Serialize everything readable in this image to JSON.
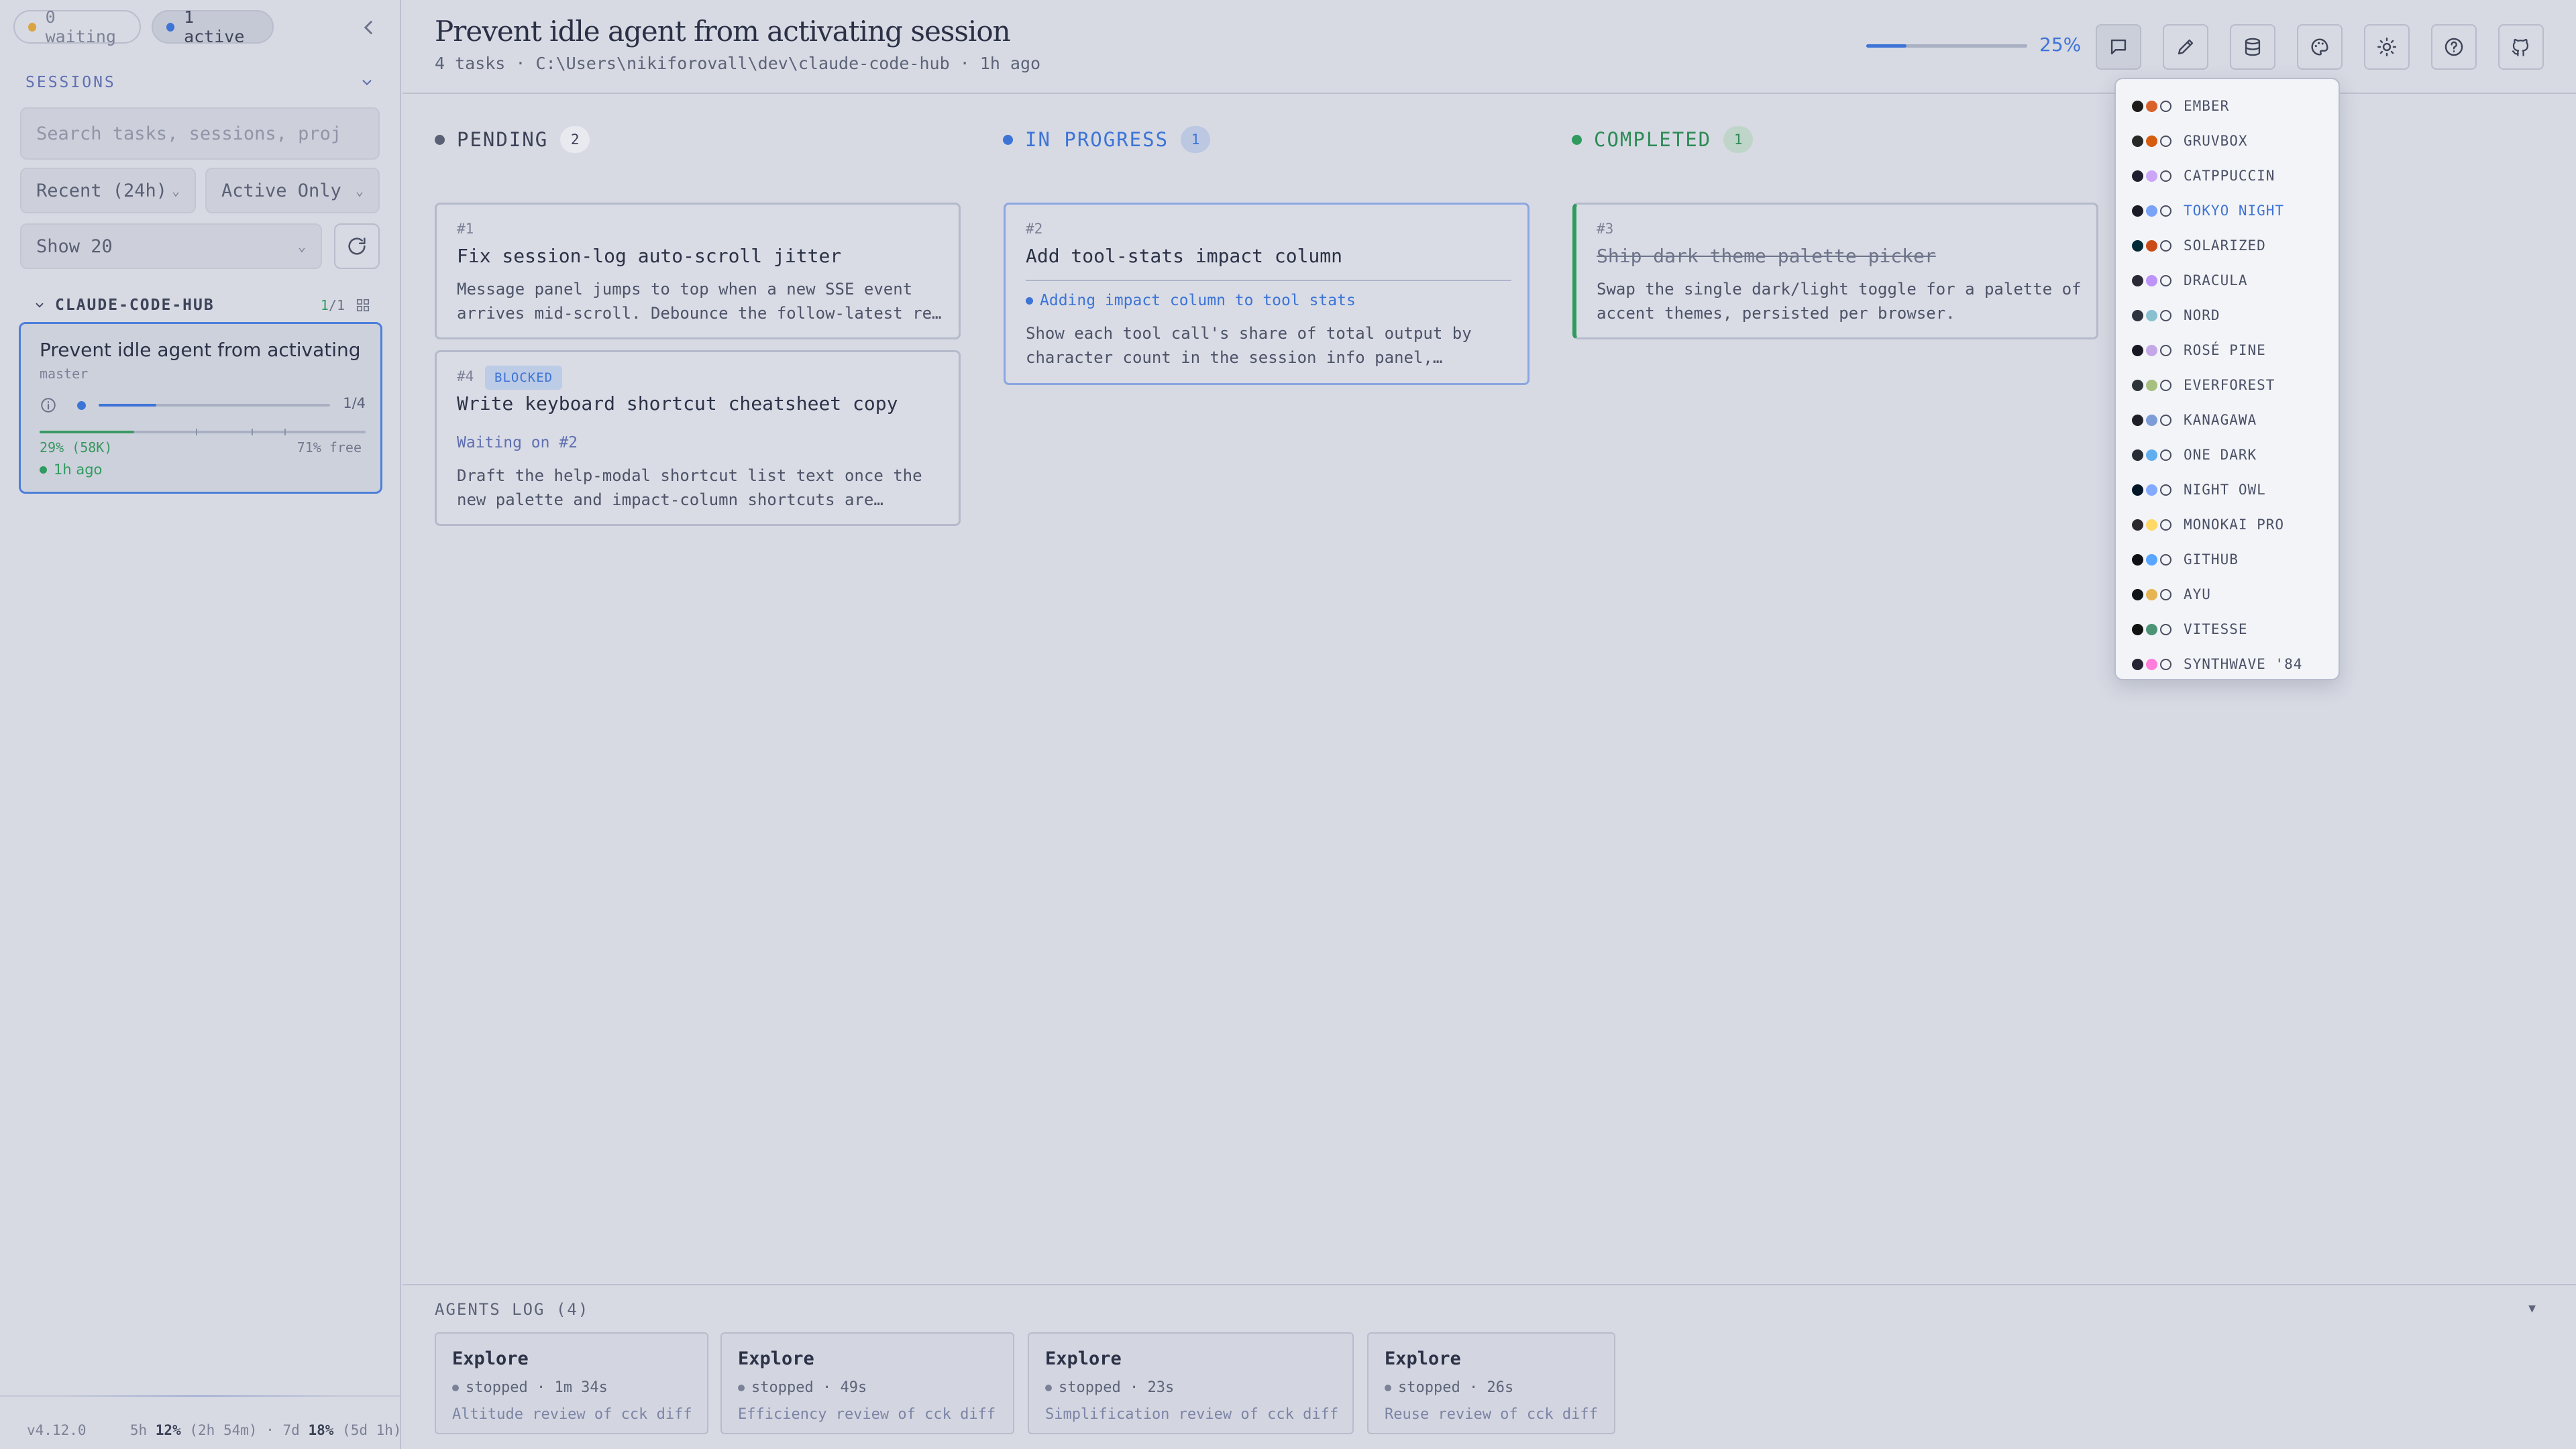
{
  "sidebar": {
    "waiting_pill": "0 waiting",
    "active_pill": "1 active",
    "sessions_label": "SESSIONS",
    "search_placeholder": "Search tasks, sessions, projects...",
    "recent_filter": "Recent (24h)",
    "active_filter": "Active Only",
    "show_count": "Show 20",
    "project": {
      "name": "CLAUDE-CODE-HUB",
      "count_active": "1",
      "count_total": "/1"
    },
    "session": {
      "title": "Prevent idle agent from activating session",
      "branch": "master",
      "progress_fraction": 0.25,
      "progress_label": "1/4",
      "context_used_fraction": 0.29,
      "context_used": "29% (58K)",
      "context_free": "71% free",
      "last_active": "1h ago"
    },
    "footer": {
      "version": "v4.12.0",
      "usage_5h_label": "5h",
      "usage_5h_pct": "12%",
      "usage_5h_time": "(2h 54m)",
      "separator": "·",
      "usage_7d_label": "7d",
      "usage_7d_pct": "18%",
      "usage_7d_time": "(5d 1h)"
    }
  },
  "header": {
    "title": "Prevent idle agent from activating session",
    "meta": "4 tasks · C:\\Users\\nikiforovall\\dev\\claude-code-hub · 1h ago",
    "progress_fraction": 0.25,
    "progress_label": "25%"
  },
  "columns": {
    "pending": {
      "label": "PENDING",
      "count": "2"
    },
    "in_progress": {
      "label": "IN PROGRESS",
      "count": "1"
    },
    "completed": {
      "label": "COMPLETED",
      "count": "1"
    }
  },
  "tasks": {
    "t1": {
      "id": "#1",
      "title": "Fix session-log auto-scroll jitter",
      "description": "Message panel jumps to top when a new SSE event arrives mid-scroll. Debounce the follow-latest re…"
    },
    "t4": {
      "id": "#4",
      "badge": "BLOCKED",
      "title": "Write keyboard shortcut cheatsheet copy",
      "waiting": "Waiting on #2",
      "description": "Draft the help-modal shortcut list text once the new palette and impact-column shortcuts are…"
    },
    "t2": {
      "id": "#2",
      "title": "Add tool-stats impact column",
      "activity": "Adding impact column to tool stats",
      "description": "Show each tool call's share of total output by character count in the session info panel,…"
    },
    "t3": {
      "id": "#3",
      "title": "Ship dark theme palette picker",
      "description": "Swap the single dark/light toggle for a palette of accent themes, persisted per browser."
    }
  },
  "themes": [
    {
      "name": "EMBER",
      "c1": "#1f1d1b",
      "c2": "#d9622b",
      "c3": "#c9b79a"
    },
    {
      "name": "GRUVBOX",
      "c1": "#282828",
      "c2": "#d65d0e",
      "c3": "#d79921"
    },
    {
      "name": "CATPPUCCIN",
      "c1": "#1e1e2e",
      "c2": "#cba6f7",
      "c3": "#89b4fa"
    },
    {
      "name": "TOKYO NIGHT",
      "c1": "#1a1b26",
      "c2": "#7aa2f7",
      "c3": "#7aa2f7"
    },
    {
      "name": "SOLARIZED",
      "c1": "#002b36",
      "c2": "#cb4b16",
      "c3": "#839496"
    },
    {
      "name": "DRACULA",
      "c1": "#282a36",
      "c2": "#bd93f9",
      "c3": "#f8f8f2"
    },
    {
      "name": "NORD",
      "c1": "#2e3440",
      "c2": "#88c0d0",
      "c3": "#eceff4"
    },
    {
      "name": "ROSÉ PINE",
      "c1": "#191724",
      "c2": "#c4a7e7",
      "c3": "#e0def4"
    },
    {
      "name": "EVERFOREST",
      "c1": "#2d353b",
      "c2": "#a7c080",
      "c3": "#d3c6aa"
    },
    {
      "name": "KANAGAWA",
      "c1": "#1f1f28",
      "c2": "#7e9cd8",
      "c3": "#dcd7ba"
    },
    {
      "name": "ONE DARK",
      "c1": "#282c34",
      "c2": "#61afef",
      "c3": "#e5e7eb"
    },
    {
      "name": "NIGHT OWL",
      "c1": "#011627",
      "c2": "#82aaff",
      "c3": "#d6deeb"
    },
    {
      "name": "MONOKAI PRO",
      "c1": "#2d2a2e",
      "c2": "#ffd866",
      "c3": "#fcfcfa"
    },
    {
      "name": "GITHUB",
      "c1": "#0d1117",
      "c2": "#58a6ff",
      "c3": "#c9d1d9"
    },
    {
      "name": "AYU",
      "c1": "#0f1419",
      "c2": "#e6b450",
      "c3": "#bfbdb6"
    },
    {
      "name": "VITESSE",
      "c1": "#121212",
      "c2": "#4d9375",
      "c3": "#dbd7ca"
    },
    {
      "name": "SYNTHWAVE '84",
      "c1": "#262335",
      "c2": "#ff7edb",
      "c3": "#f4eee4"
    }
  ],
  "active_theme": "TOKYO NIGHT",
  "agents_log": {
    "title": "AGENTS LOG (4)",
    "agents": [
      {
        "name": "Explore",
        "status": "stopped · 1m 34s",
        "desc": "Altitude review of cck diff"
      },
      {
        "name": "Explore",
        "status": "stopped · 49s",
        "desc": "Efficiency review of cck diff"
      },
      {
        "name": "Explore",
        "status": "stopped · 23s",
        "desc": "Simplification review of cck diff"
      },
      {
        "name": "Explore",
        "status": "stopped · 26s",
        "desc": "Reuse review of cck diff"
      }
    ]
  },
  "colors": {
    "accent": "#3d74d6",
    "success": "#2f9b5e",
    "waiting": "#d9a441",
    "background": "#d7dae3"
  },
  "icons": {
    "collapse": "chevron-left-icon",
    "refresh": "refresh-icon",
    "grid": "grid-icon",
    "chat": "chat-icon",
    "edit": "pencil-icon",
    "database": "database-icon",
    "palette": "palette-icon",
    "theme_toggle": "sun-icon",
    "help": "help-icon",
    "github": "github-icon",
    "info": "info-icon"
  }
}
